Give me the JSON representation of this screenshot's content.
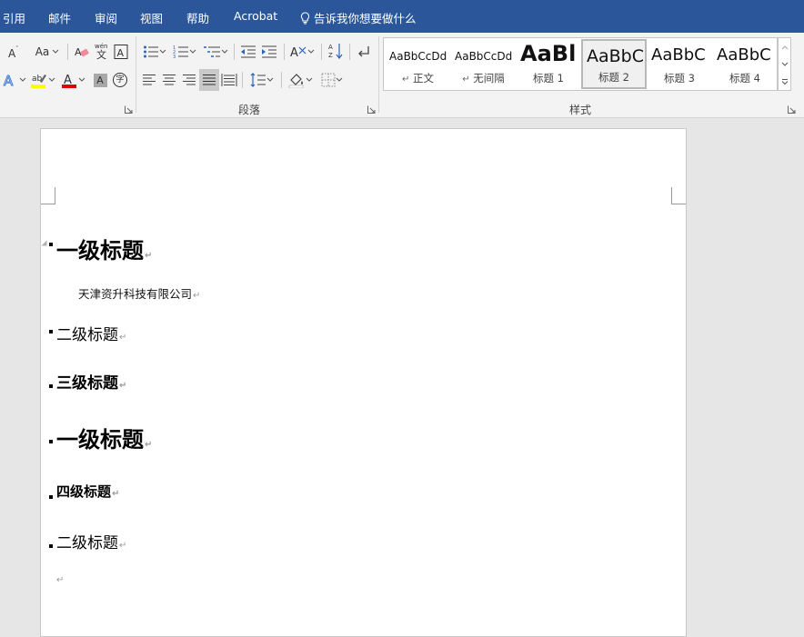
{
  "menu": {
    "tabs": [
      "引用",
      "邮件",
      "审阅",
      "视图",
      "帮助",
      "Acrobat"
    ],
    "tell_me": "告诉我你想要做什么"
  },
  "ribbon": {
    "font": {
      "change_case_label": "Aa",
      "phonetic_label": "wén",
      "char_shading_label": "A",
      "enclose_char_label": "字"
    },
    "paragraph_label": "段落",
    "styles_label": "样式",
    "styles": [
      {
        "sample": "AaBbCcDd",
        "name": "正文",
        "mark": "↵"
      },
      {
        "sample": "AaBbCcDd",
        "name": "无间隔",
        "mark": "↵"
      },
      {
        "sample": "AaBl",
        "name": "标题 1",
        "mark": ""
      },
      {
        "sample": "AaBbC",
        "name": "标题 2",
        "mark": ""
      },
      {
        "sample": "AaBbC",
        "name": "标题 3",
        "mark": ""
      },
      {
        "sample": "AaBbC",
        "name": "标题 4",
        "mark": ""
      }
    ],
    "colors": {
      "highlight": "#ffff00",
      "font_color": "#e00000",
      "ribbon_bg": "#f3f3f3",
      "accent": "#2b579a"
    }
  },
  "document": {
    "blocks": [
      {
        "level": "h1",
        "text": "一级标题"
      },
      {
        "level": "body",
        "text": "天津资升科技有限公司"
      },
      {
        "level": "h2",
        "text": "二级标题"
      },
      {
        "level": "h3",
        "text": "三级标题"
      },
      {
        "level": "h1",
        "text": "一级标题"
      },
      {
        "level": "h4",
        "text": "四级标题"
      },
      {
        "level": "h2",
        "text": "二级标题"
      },
      {
        "level": "empty",
        "text": ""
      }
    ],
    "paragraph_mark": "↵"
  }
}
